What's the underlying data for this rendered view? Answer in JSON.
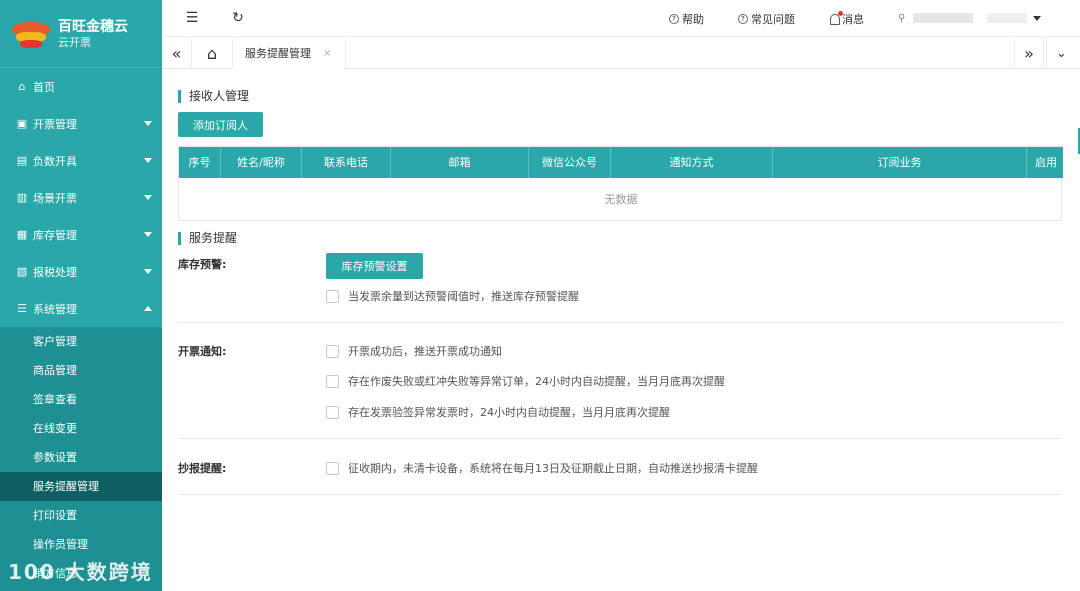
{
  "brand": {
    "title": "百旺金穗云",
    "subtitle": "云开票"
  },
  "sidebar": {
    "items": [
      {
        "label": "首页",
        "icon": "home-icon",
        "glyph": "⌂"
      },
      {
        "label": "开票管理",
        "icon": "invoice-icon",
        "glyph": "▣"
      },
      {
        "label": "负数开具",
        "icon": "negative-invoice-icon",
        "glyph": "▤"
      },
      {
        "label": "场景开票",
        "icon": "scene-icon",
        "glyph": "▥"
      },
      {
        "label": "库存管理",
        "icon": "inventory-icon",
        "glyph": "▦"
      },
      {
        "label": "报税处理",
        "icon": "tax-icon",
        "glyph": "▧"
      },
      {
        "label": "系统管理",
        "icon": "settings-sliders-icon",
        "glyph": "☰"
      }
    ],
    "submenu": [
      "客户管理",
      "商品管理",
      "签章查看",
      "在线变更",
      "参数设置",
      "服务提醒管理",
      "打印设置",
      "操作员管理",
      "销方信息"
    ],
    "active_sub": "服务提醒管理",
    "watermark": "100 大数跨境"
  },
  "topbar": {
    "help": "帮助",
    "faq": "常见问题",
    "messages": "消息"
  },
  "tabs": {
    "active": "服务提醒管理",
    "close": "×"
  },
  "receiver": {
    "title": "接收人管理",
    "add_button": "添加订阅人",
    "columns": [
      "序号",
      "姓名/昵称",
      "联系电话",
      "邮箱",
      "微信公众号",
      "通知方式",
      "订阅业务",
      "启用"
    ],
    "empty_text": "无数据"
  },
  "service": {
    "title": "服务提醒",
    "inventory": {
      "label": "库存预警:",
      "button": "库存预警设置",
      "options": [
        "当发票余量到达预警阈值时，推送库存预警提醒"
      ]
    },
    "issuance": {
      "label": "开票通知:",
      "options": [
        "开票成功后，推送开票成功通知",
        "存在作废失败或红冲失败等异常订单，24小时内自动提醒，当月月底再次提醒",
        "存在发票验签异常发票时，24小时内自动提醒，当月月底再次提醒"
      ]
    },
    "report": {
      "label": "抄报提醒:",
      "options": [
        "征收期内，未清卡设备，系统将在每月13日及征期截止日期，自动推送抄报清卡提醒"
      ]
    }
  },
  "colors": {
    "accent": "#2aa7a8",
    "submenu_bg": "#1e8f92",
    "active_bg": "#0f5f62"
  }
}
